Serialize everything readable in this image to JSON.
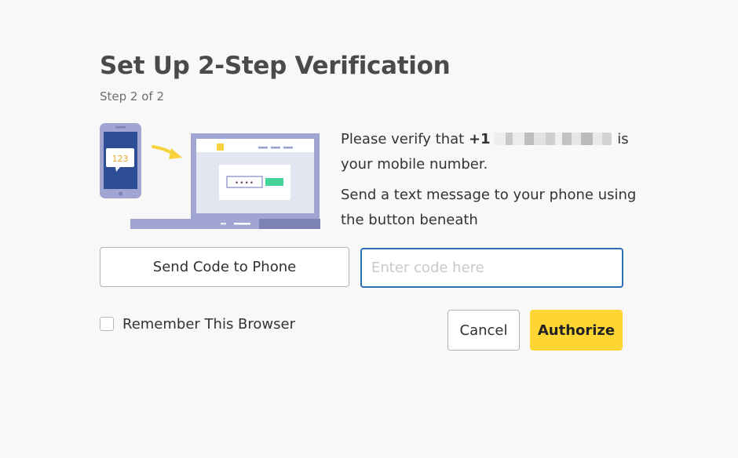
{
  "header": {
    "title": "Set Up 2-Step Verification",
    "step": "Step 2 of 2"
  },
  "illustration": {
    "phone_code": "123",
    "masked_password": "••••"
  },
  "message": {
    "verify_prefix": "Please verify that ",
    "phone_country_code": "+1",
    "verify_suffix": " is your mobile number.",
    "instruction": "Send a text message to your phone using the button beneath"
  },
  "actions": {
    "send_code_label": "Send Code to Phone",
    "code_placeholder": "Enter code here",
    "code_value": "",
    "remember_label": "Remember This Browser",
    "remember_checked": false,
    "cancel_label": "Cancel",
    "authorize_label": "Authorize"
  },
  "colors": {
    "accent_yellow": "#fed634",
    "input_focus_blue": "#2c6fb6",
    "illustration_purple": "#a0a5d2",
    "phone_screen": "#2d4e96",
    "confirm_green": "#47d49b"
  }
}
